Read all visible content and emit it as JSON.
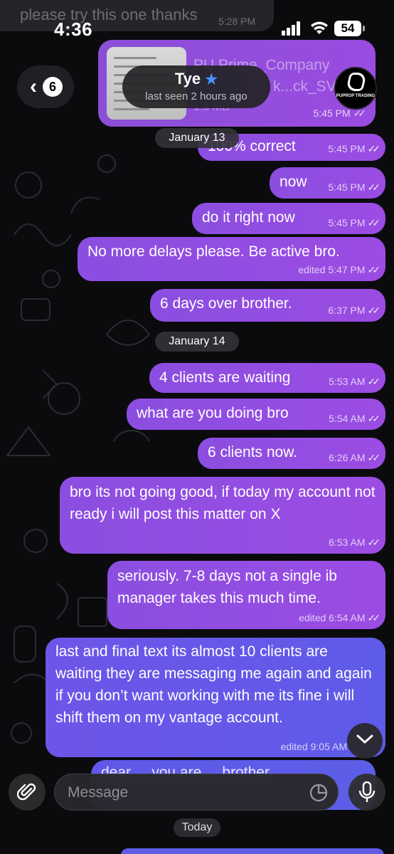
{
  "status_bar": {
    "time": "4:36",
    "battery": "54"
  },
  "previous_message": {
    "text": "please try this one thanks",
    "time": "5:28 PM"
  },
  "document_message": {
    "name_line1": "PU Prime_Company",
    "name_line2": "k...ck_SV",
    "size": "1.8 MB",
    "time": "5:45 PM"
  },
  "header": {
    "back_count": "6",
    "contact_name": "Tye",
    "last_seen": "last seen 2 hours ago",
    "avatar_text": "PUPROP TRADING"
  },
  "dates": {
    "jan13": "January 13",
    "jan14": "January 14",
    "today": "Today"
  },
  "messages": [
    {
      "text": "100% correct",
      "meta": "5:45 PM"
    },
    {
      "text": "now",
      "meta": "5:45 PM"
    },
    {
      "text": "do it right now",
      "meta": "5:45 PM"
    },
    {
      "text": "No more delays please. Be active bro.",
      "meta": "edited 5:47 PM"
    },
    {
      "text": "6 days over brother.",
      "meta": "6:37 PM"
    },
    {
      "text": "4 clients are waiting",
      "meta": "5:53 AM"
    },
    {
      "text": "what are you doing bro",
      "meta": "5:54 AM"
    },
    {
      "text": "6 clients now.",
      "meta": "6:26 AM"
    },
    {
      "text": "bro its not going good, if today my account not ready i will post this matter on X",
      "meta": "6:53 AM"
    },
    {
      "text": "seriously. 7-8 days not a single ib manager takes this much time.",
      "meta": "edited 6:54 AM"
    },
    {
      "text": "last and final text its almost 10 clients are waiting they are messaging me again and again if you don’t want working with me its fine i will shift them on my vantage account.",
      "meta": "edited 9:05 AM"
    }
  ],
  "peek_message": {
    "text": "dear ... you are ... brother"
  },
  "composer": {
    "placeholder": "Message"
  },
  "colors": {
    "bubble_purple": "#9b4ce3",
    "bubble_blue": "#5e5be8",
    "star_blue": "#4a8fff"
  }
}
